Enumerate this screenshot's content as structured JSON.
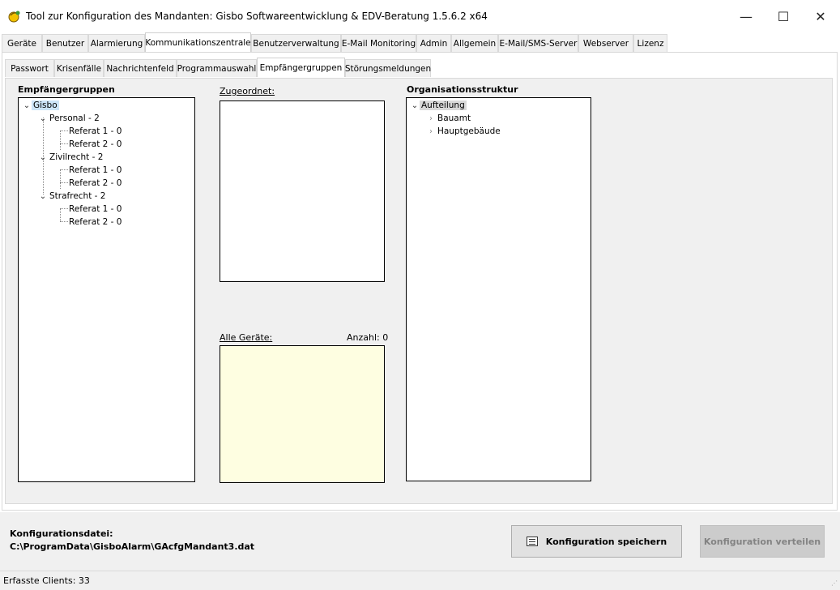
{
  "window": {
    "title": "Tool zur Konfiguration des Mandanten: Gisbo Softwareentwicklung & EDV-Beratung 1.5.6.2 x64",
    "minimize": "—",
    "maximize": "☐",
    "close": "✕"
  },
  "main_tabs": [
    {
      "label": "Geräte"
    },
    {
      "label": "Benutzer"
    },
    {
      "label": "Alarmierung"
    },
    {
      "label": "Kommunikationszentrale",
      "active": true
    },
    {
      "label": "Benutzerverwaltung"
    },
    {
      "label": "E-Mail Monitoring"
    },
    {
      "label": "Admin"
    },
    {
      "label": "Allgemein"
    },
    {
      "label": "E-Mail/SMS-Server"
    },
    {
      "label": "Webserver"
    },
    {
      "label": "Lizenz"
    }
  ],
  "sub_tabs": [
    {
      "label": "Passwort"
    },
    {
      "label": "Krisenfälle"
    },
    {
      "label": "Nachrichtenfeld"
    },
    {
      "label": "Programmauswahl"
    },
    {
      "label": "Empfängergruppen",
      "active": true
    },
    {
      "label": "Störungsmeldungen"
    }
  ],
  "empfaengergruppen": {
    "heading": "Empfängergruppen",
    "tree": [
      {
        "label": "Gisbo",
        "level": 0,
        "expanded": true,
        "selected": true
      },
      {
        "label": "Personal - 2",
        "level": 1,
        "expanded": true
      },
      {
        "label": "Referat 1 - 0",
        "level": 2
      },
      {
        "label": "Referat 2 - 0",
        "level": 2
      },
      {
        "label": "Zivilrecht - 2",
        "level": 1,
        "expanded": true
      },
      {
        "label": "Referat 1 - 0",
        "level": 2
      },
      {
        "label": "Referat 2 - 0",
        "level": 2
      },
      {
        "label": "Strafrecht - 2",
        "level": 1,
        "expanded": true
      },
      {
        "label": "Referat 1 - 0",
        "level": 2
      },
      {
        "label": "Referat 2 - 0",
        "level": 2
      }
    ]
  },
  "zugeordnet": {
    "heading": "Zugeordnet:"
  },
  "alle_geraete": {
    "heading": "Alle Geräte:",
    "count_label": "Anzahl: 0"
  },
  "organisationsstruktur": {
    "heading": "Organisationsstruktur",
    "tree": [
      {
        "label": "Aufteilung",
        "level": 0,
        "expanded": true,
        "selected": true
      },
      {
        "label": "Bauamt",
        "level": 1,
        "expanded": false
      },
      {
        "label": "Hauptgebäude",
        "level": 1,
        "expanded": false
      }
    ]
  },
  "footer": {
    "config_label": "Konfigurationsdatei:",
    "config_path": "C:\\ProgramData\\GisboAlarm\\GAcfgMandant3.dat",
    "save_button": "Konfiguration speichern",
    "distribute_button": "Konfiguration verteilen"
  },
  "status": {
    "text": "Erfasste Clients: 33"
  }
}
